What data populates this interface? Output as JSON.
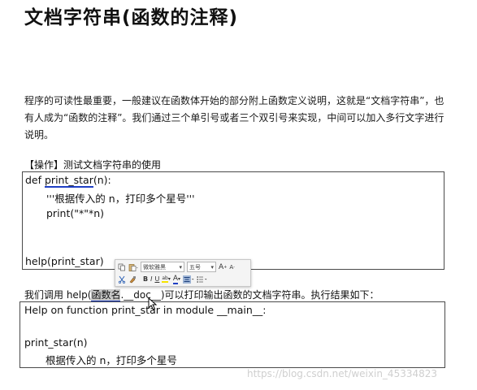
{
  "title": "文档字符串(函数的注释)",
  "intro": "程序的可读性最重要，一般建议在函数体开始的部分附上函数定义说明，这就是“文档字符串”，也有人成为“函数的注释”。我们通过三个单引号或者三个双引号来实现，中间可以加入多行文字进行说明。",
  "op_label": "【操作】测试文档字符串的使用",
  "code": {
    "def_kw": "def ",
    "func_name": "print_star",
    "def_tail": "(n):",
    "docstring": "'''根据传入的 n，打印多个星号'''",
    "print_stmt": "print(\"*\"*n)",
    "help_call": "help(print_star)"
  },
  "call_line": {
    "prefix": "我们调用 help(",
    "highlight": "函数名",
    "middle": ".__doc__)可以打印输出函数的文档字符串。执行结果如下："
  },
  "result": {
    "line1": "Help on function print_star in module __main__:",
    "line2": "print_star(n)",
    "line3": "根据传入的 n，打印多个星号"
  },
  "toolbar": {
    "font_name": "微软雅黑",
    "font_size": "五号",
    "grow_label": "A",
    "shrink_label": "A",
    "bold": "B",
    "italic": "I",
    "underline": "U",
    "highlight": "ab",
    "font_color": "A",
    "font_color_value": "#1f3fc4"
  },
  "watermark": "https://blog.csdn.net/weixin_45334823"
}
